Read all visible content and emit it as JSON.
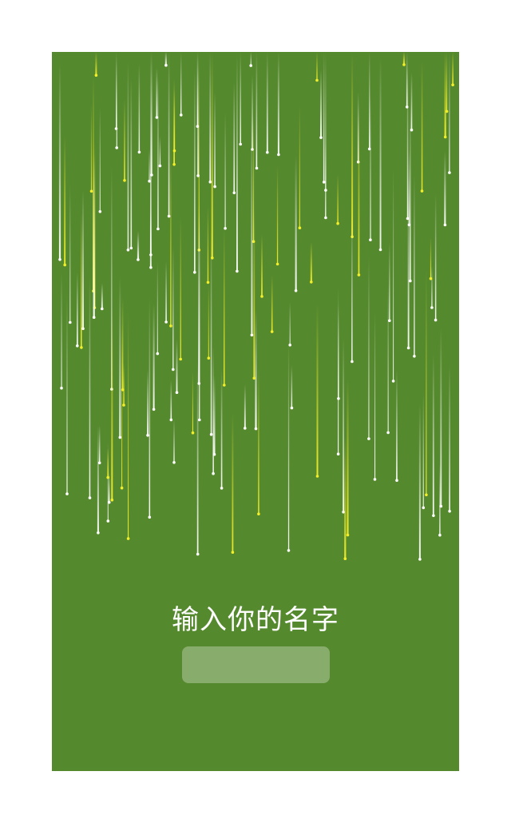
{
  "screen": {
    "background_color": "#55892d",
    "rain_colors": [
      "#ffffff",
      "#f2ee2a"
    ]
  },
  "prompt": {
    "label": "输入你的名字"
  },
  "name_input": {
    "value": "",
    "placeholder": ""
  }
}
